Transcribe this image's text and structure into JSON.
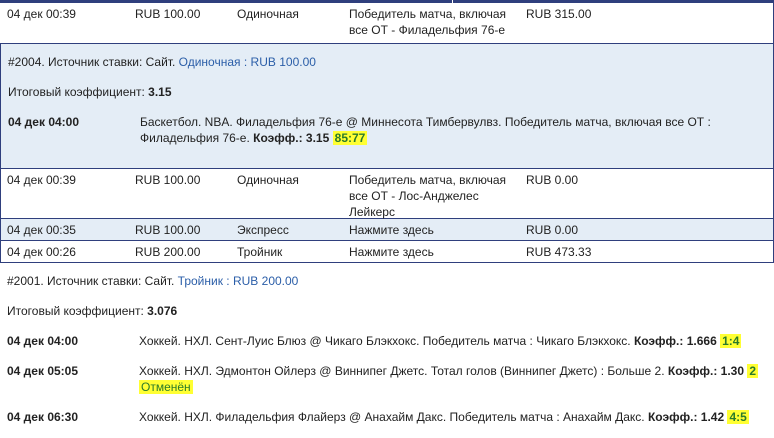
{
  "rows": [
    {
      "date": "04 дек 00:39",
      "amount": "RUB 100.00",
      "type": "Одиночная",
      "bet_line1": "Победитель матча, включая",
      "bet_line2": "все ОТ - Филадельфия 76-е",
      "payout": "RUB 315.00"
    },
    {
      "date": "04 дек 00:39",
      "amount": "RUB 100.00",
      "type": "Одиночная",
      "bet_line1": "Победитель матча, включая",
      "bet_line2": "все ОТ - Лос-Анджелес",
      "bet_line3": "Лейкерс",
      "payout": "RUB 0.00"
    },
    {
      "date": "04 дек 00:35",
      "amount": "RUB 100.00",
      "type": "Экспресс",
      "bet": "Нажмите здесь",
      "payout": "RUB 0.00"
    },
    {
      "date": "04 дек 00:26",
      "amount": "RUB 200.00",
      "type": "Тройник",
      "bet": "Нажмите здесь",
      "payout": "RUB 473.33"
    }
  ],
  "detail2004": {
    "header_prefix": "#2004. Источник ставки: Сайт. ",
    "header_type": "Одиночная",
    "header_sep": " : ",
    "header_amount": "RUB 100.00",
    "coef_label": "Итоговый коэффициент: ",
    "coef_value": "3.15",
    "event": {
      "time": "04 дек 04:00",
      "line1": "Баскетбол. NBA. Филадельфия 76-е @ Миннесота Тимбервулвз. Победитель матча, включая все ОТ :",
      "line2": "Филадельфия 76-е. ",
      "coef_label": "Коэфф.: 3.15",
      "score": "85:77"
    }
  },
  "detail2001": {
    "header_prefix": "#2001. Источник ставки: Сайт. ",
    "header_type": "Тройник",
    "header_sep": " : ",
    "header_amount": "RUB 200.00",
    "coef_label": "Итоговый коэффициент: ",
    "coef_value": "3.076",
    "events": [
      {
        "time": "04 дек 04:00",
        "text": "Хоккей. НХЛ. Сент-Луис Блюз @ Чикаго Блэкхокс. Победитель матча : Чикаго Блэкхокс. ",
        "coef": "Коэфф.: 1.666",
        "score": "1:4"
      },
      {
        "time": "04 дек 05:05",
        "text": "Хоккей. НХЛ. Эдмонтон Ойлерз @ Виннипег Джетс. Тотал голов (Виннипег Джетс) : Больше 2. ",
        "coef": "Коэфф.: 1.30",
        "score": "2",
        "status": "Отменён"
      },
      {
        "time": "04 дек 06:30",
        "text": "Хоккей. НХЛ. Филадельфия Флайерз @ Анахайм Дакс. Победитель матча : Анахайм Дакс. ",
        "coef": "Коэфф.: 1.42",
        "score": "4:5"
      }
    ]
  }
}
